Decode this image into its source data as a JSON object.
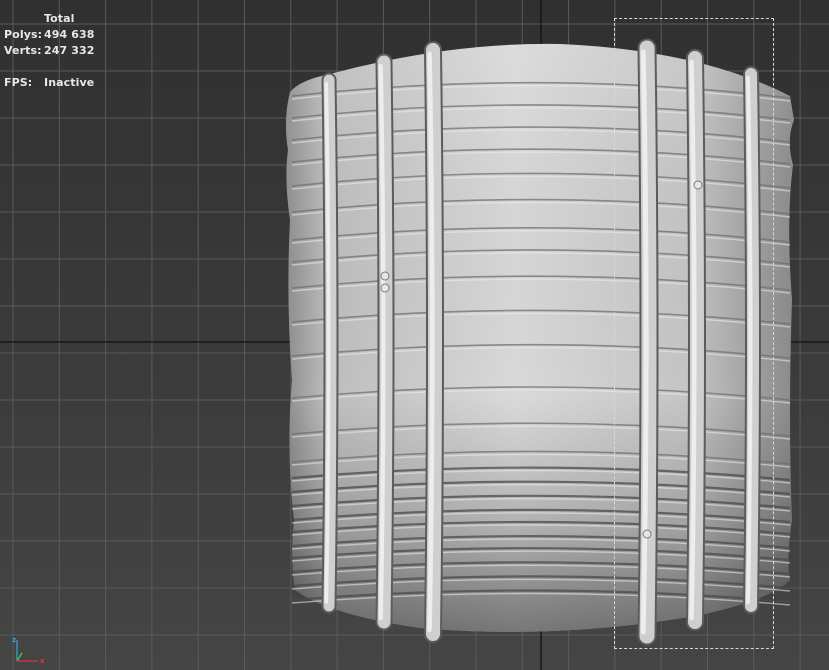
{
  "viewport_stats": {
    "header": "Total",
    "polys_label": "Polys:",
    "polys_value": "494 638",
    "verts_label": "Verts:",
    "verts_value": "247 332",
    "fps_label": "FPS:",
    "fps_value": "Inactive"
  },
  "axis_gizmo": {
    "z_label": "z",
    "x_label": "x",
    "z_color": "#3aa0d8",
    "x_color": "#d83a3a",
    "y_color": "#3ad83a"
  },
  "colors": {
    "viewport_bg": "#3a3a3a",
    "grid_line": "#5a5a5a",
    "grid_axis": "#111111",
    "model_base": "#a8a8a8",
    "selection_box": "#d8d8d8"
  },
  "icons": [
    "axis-tripod-icon"
  ]
}
